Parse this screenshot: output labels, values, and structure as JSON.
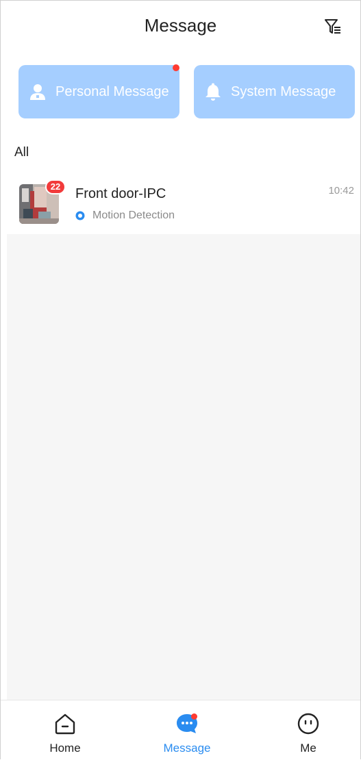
{
  "header": {
    "title": "Message",
    "filter_icon": "filter-list-icon"
  },
  "quick_actions": {
    "personal": {
      "label": "Personal Message",
      "icon": "person-icon",
      "has_unread_dot": true
    },
    "system": {
      "label": "System Message",
      "icon": "bell-icon",
      "has_unread_dot": false
    },
    "card_color": "#a5ceff"
  },
  "section": {
    "label": "All"
  },
  "messages": [
    {
      "device": "Front door-IPC",
      "time": "10:42",
      "event": "Motion Detection",
      "unread_count": "22"
    }
  ],
  "tabs": [
    {
      "label": "Home",
      "icon": "home-icon",
      "active": false
    },
    {
      "label": "Message",
      "icon": "chat-bubble-icon",
      "active": true,
      "has_unread_dot": true
    },
    {
      "label": "Me",
      "icon": "smiley-face-icon",
      "active": false
    }
  ],
  "colors": {
    "accent": "#2a8cf0",
    "badge": "#f23b3b",
    "dot": "#ff3b30",
    "list_background": "#f6f6f6"
  }
}
